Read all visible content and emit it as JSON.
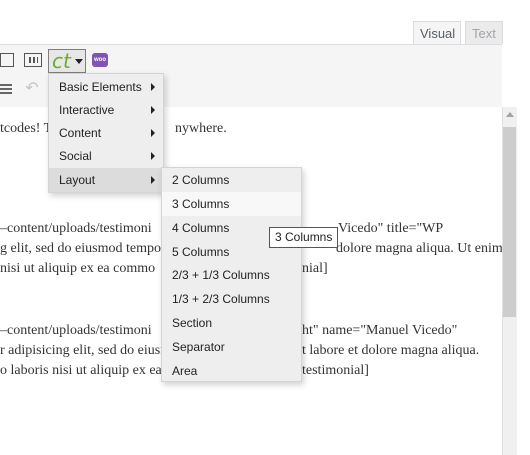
{
  "tabs": {
    "visual": "Visual",
    "text": "Text"
  },
  "toolbar": {
    "woo_label": "woo",
    "ct_label": "ct"
  },
  "editor_lines": [
    "tcodes! Tr",
    "nywhere.",
    "–content/uploads/testimoni",
    "Vicedo\" title=\"WP",
    "g elit, sed do eiusmod tempo",
    "dolore magna aliqua. Ut enim",
    "nisi ut aliquip ex ea commo",
    "nial]",
    "–content/uploads/testimoni",
    "ht\" name=\"Manuel Vicedo\"",
    "r adipisicing elit, sed do eiusn",
    "t labore et dolore magna aliqua.",
    "o laboris nisi ut aliquip ex ea",
    "testimonial]"
  ],
  "main_menu": [
    {
      "label": "Basic Elements"
    },
    {
      "label": "Interactive"
    },
    {
      "label": "Content"
    },
    {
      "label": "Social"
    },
    {
      "label": "Layout"
    }
  ],
  "layout_menu": [
    {
      "label": "2 Columns"
    },
    {
      "label": "3 Columns"
    },
    {
      "label": "4 Columns"
    },
    {
      "label": "5 Columns"
    },
    {
      "label": "2/3 + 1/3 Columns"
    },
    {
      "label": "1/3 + 2/3 Columns"
    },
    {
      "label": "Section"
    },
    {
      "label": "Separator"
    },
    {
      "label": "Area"
    }
  ],
  "tooltip": "3 Columns"
}
